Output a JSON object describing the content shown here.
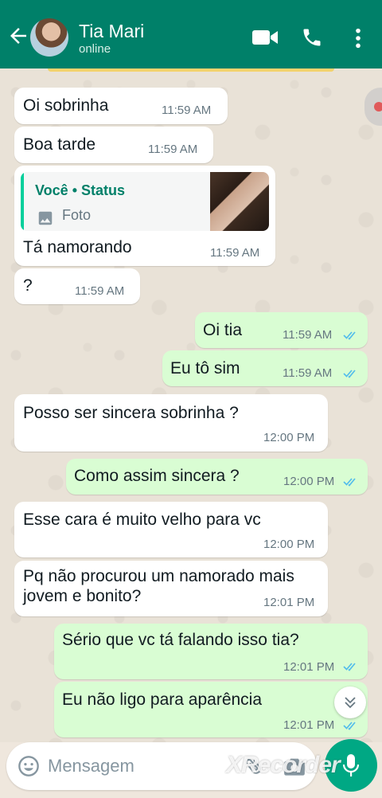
{
  "header": {
    "contact_name": "Tia Mari",
    "status": "online",
    "icons": [
      "back-arrow-icon",
      "avatar",
      "video-call-icon",
      "phone-icon",
      "more-vert-icon"
    ]
  },
  "messages": [
    {
      "direction": "in",
      "text": "Oi sobrinha",
      "time": "11:59 AM"
    },
    {
      "direction": "in",
      "text": "Boa tarde",
      "time": "11:59 AM"
    },
    {
      "direction": "in",
      "quote": {
        "author": "Você • Status",
        "type": "Foto"
      },
      "text": "Tá namorando",
      "time": "11:59 AM"
    },
    {
      "direction": "in",
      "text": "?",
      "time": "11:59 AM"
    },
    {
      "direction": "out",
      "text": "Oi tia",
      "time": "11:59 AM",
      "status": "read"
    },
    {
      "direction": "out",
      "text": "Eu tô sim",
      "time": "11:59 AM",
      "status": "read"
    },
    {
      "direction": "in",
      "text": "Posso ser sincera sobrinha ?",
      "time": "12:00 PM"
    },
    {
      "direction": "out",
      "text": "Como assim sincera ?",
      "time": "12:00 PM",
      "status": "read"
    },
    {
      "direction": "in",
      "text": "Esse cara é muito velho para vc",
      "time": "12:00 PM"
    },
    {
      "direction": "in",
      "text": "Pq não procurou um namorado mais\njovem e bonito?",
      "time": "12:01 PM"
    },
    {
      "direction": "out",
      "text": "Sério que vc tá falando isso tia?",
      "time": "12:01 PM",
      "status": "read"
    },
    {
      "direction": "out",
      "text": "Eu não ligo para aparência",
      "time": "12:01 PM",
      "status": "read"
    }
  ],
  "composer": {
    "placeholder": "Mensagem"
  },
  "watermark": "XRecorder",
  "colors": {
    "header": "#008069",
    "incoming": "#ffffff",
    "outgoing": "#d9fdd3",
    "read_ticks": "#53bdeb",
    "mic": "#00a884"
  }
}
